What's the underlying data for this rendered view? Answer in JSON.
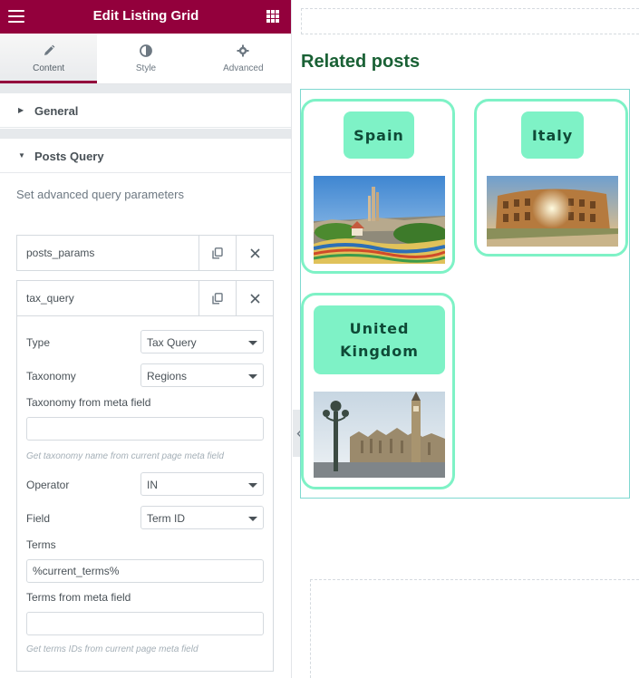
{
  "header": {
    "title": "Edit Listing Grid",
    "menu_icon": "hamburger-icon",
    "widgets_icon": "grid-icon"
  },
  "tabs": [
    {
      "label": "Content",
      "icon": "pencil-icon",
      "active": true
    },
    {
      "label": "Style",
      "icon": "half-circle-icon",
      "active": false
    },
    {
      "label": "Advanced",
      "icon": "gear-icon",
      "active": false
    }
  ],
  "sections": {
    "general": {
      "title": "General",
      "expanded": false
    },
    "posts_query": {
      "title": "Posts Query",
      "expanded": true,
      "description": "Set advanced query parameters"
    }
  },
  "repeater": {
    "rows": [
      {
        "label": "posts_params"
      },
      {
        "label": "tax_query"
      }
    ],
    "tax_query": {
      "type": {
        "label": "Type",
        "value": "Tax Query"
      },
      "taxonomy": {
        "label": "Taxonomy",
        "value": "Regions"
      },
      "taxonomy_meta": {
        "label": "Taxonomy from meta field",
        "value": "",
        "help": "Get taxonomy name from current page meta field"
      },
      "operator": {
        "label": "Operator",
        "value": "IN"
      },
      "field": {
        "label": "Field",
        "value": "Term ID"
      },
      "terms": {
        "label": "Terms",
        "value": "%current_terms%"
      },
      "terms_meta": {
        "label": "Terms from meta field",
        "value": "",
        "help": "Get terms IDs from current page meta field"
      }
    }
  },
  "canvas": {
    "heading": "Related posts",
    "collapse_icon": "chevron-left-icon",
    "cards": [
      {
        "title": "Spain",
        "image": "park-guell-barcelona"
      },
      {
        "title": "Italy",
        "image": "colosseum-rome"
      },
      {
        "title": "United Kingdom",
        "image": "westminster-london"
      }
    ]
  },
  "colors": {
    "header_bg": "#93003c",
    "card_accent": "#7ef2c6",
    "heading": "#1a6135",
    "badge_text": "#0f4a37"
  }
}
